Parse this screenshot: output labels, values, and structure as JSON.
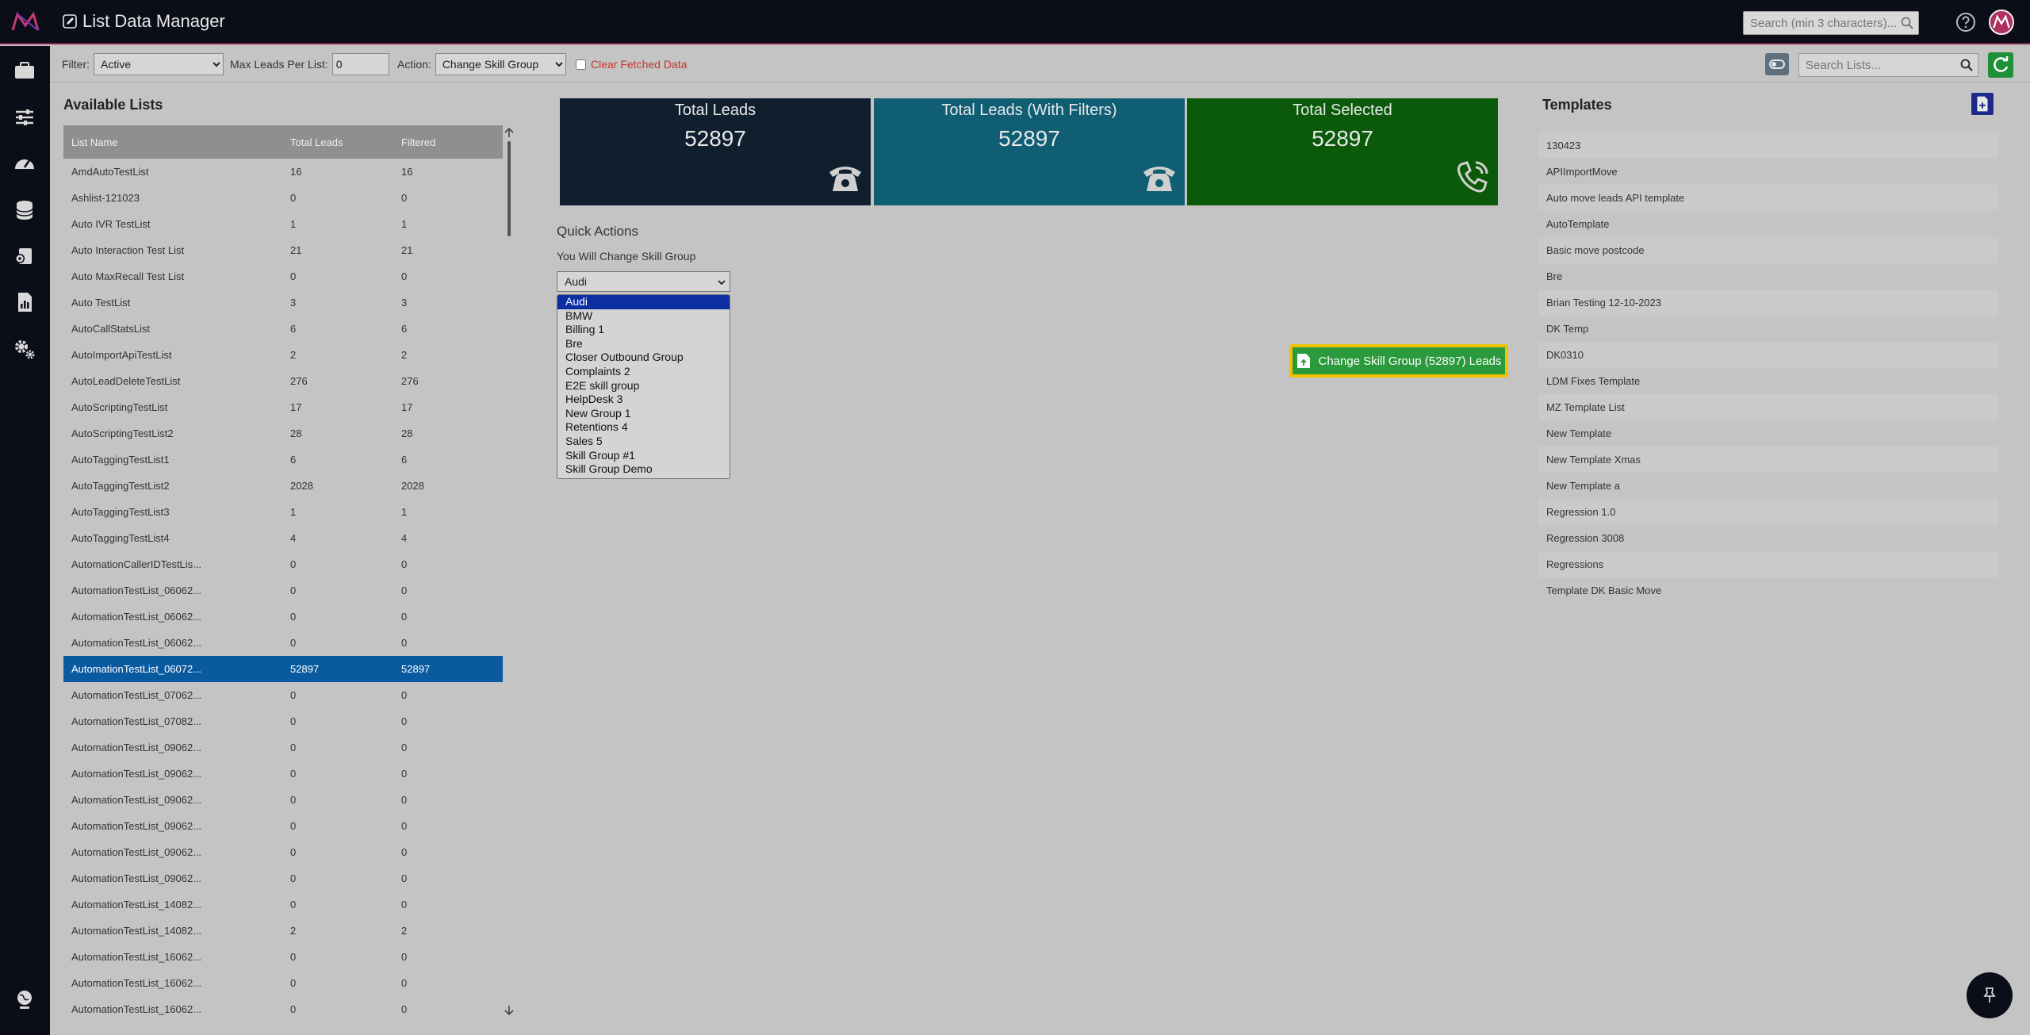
{
  "app": {
    "title": "List Data Manager",
    "search_placeholder": "Search (min 3 characters)..."
  },
  "filterbar": {
    "filter_label": "Filter:",
    "filter_value": "Active",
    "max_leads_label": "Max Leads Per List:",
    "max_leads_value": "0",
    "action_label": "Action:",
    "action_value": "Change Skill Group",
    "clear_label": "Clear Fetched Data",
    "list_search_placeholder": "Search Lists..."
  },
  "lists": {
    "title": "Available Lists",
    "columns": [
      "List Name",
      "Total Leads",
      "Filtered"
    ],
    "rows": [
      [
        "AmdAutoTestList",
        "16",
        "16"
      ],
      [
        "Ashlist-121023",
        "0",
        "0"
      ],
      [
        "Auto IVR TestList",
        "1",
        "1"
      ],
      [
        "Auto Interaction Test List",
        "21",
        "21"
      ],
      [
        "Auto MaxRecall Test List",
        "0",
        "0"
      ],
      [
        "Auto TestList",
        "3",
        "3"
      ],
      [
        "AutoCallStatsList",
        "6",
        "6"
      ],
      [
        "AutoImportApiTestList",
        "2",
        "2"
      ],
      [
        "AutoLeadDeleteTestList",
        "276",
        "276"
      ],
      [
        "AutoScriptingTestList",
        "17",
        "17"
      ],
      [
        "AutoScriptingTestList2",
        "28",
        "28"
      ],
      [
        "AutoTaggingTestList1",
        "6",
        "6"
      ],
      [
        "AutoTaggingTestList2",
        "2028",
        "2028"
      ],
      [
        "AutoTaggingTestList3",
        "1",
        "1"
      ],
      [
        "AutoTaggingTestList4",
        "4",
        "4"
      ],
      [
        "AutomationCallerIDTestLis...",
        "0",
        "0"
      ],
      [
        "AutomationTestList_06062...",
        "0",
        "0"
      ],
      [
        "AutomationTestList_06062...",
        "0",
        "0"
      ],
      [
        "AutomationTestList_06062...",
        "0",
        "0"
      ],
      [
        "AutomationTestList_06072...",
        "52897",
        "52897"
      ],
      [
        "AutomationTestList_07062...",
        "0",
        "0"
      ],
      [
        "AutomationTestList_07082...",
        "0",
        "0"
      ],
      [
        "AutomationTestList_09062...",
        "0",
        "0"
      ],
      [
        "AutomationTestList_09062...",
        "0",
        "0"
      ],
      [
        "AutomationTestList_09062...",
        "0",
        "0"
      ],
      [
        "AutomationTestList_09062...",
        "0",
        "0"
      ],
      [
        "AutomationTestList_09062...",
        "0",
        "0"
      ],
      [
        "AutomationTestList_09062...",
        "0",
        "0"
      ],
      [
        "AutomationTestList_14082...",
        "0",
        "0"
      ],
      [
        "AutomationTestList_14082...",
        "2",
        "2"
      ],
      [
        "AutomationTestList_16062...",
        "0",
        "0"
      ],
      [
        "AutomationTestList_16062...",
        "0",
        "0"
      ],
      [
        "AutomationTestList_16062...",
        "0",
        "0"
      ]
    ],
    "selected_index": 19
  },
  "cards": {
    "total_label": "Total Leads",
    "total_value": "52897",
    "filters_label": "Total Leads (With Filters)",
    "filters_value": "52897",
    "selected_label": "Total Selected",
    "selected_value": "52897"
  },
  "quick_actions": {
    "title": "Quick Actions",
    "description": "You Will Change Skill Group",
    "selected": "Audi",
    "options": [
      "Audi",
      "BMW",
      "Billing 1",
      "Bre",
      "Closer Outbound Group",
      "Complaints 2",
      "E2E skill group",
      "HelpDesk 3",
      "New Group 1",
      "Retentions 4",
      "Sales 5",
      "Skill Group #1",
      "Skill Group Demo"
    ],
    "button_label": "Change Skill Group (52897) Leads"
  },
  "templates": {
    "title": "Templates",
    "items": [
      "130423",
      "APIImportMove",
      "Auto move leads API template",
      "AutoTemplate",
      "Basic move postcode",
      "Bre",
      "Brian Testing 12-10-2023",
      "DK Temp",
      "DK0310",
      "LDM Fixes Template",
      "MZ Template List",
      "New Template",
      "New Template Xmas",
      "New Template a",
      "Regression 1.0",
      "Regression 3008",
      "Regressions",
      "Template DK Basic Move"
    ]
  },
  "colors": {
    "accent": "#7a1f4a",
    "selected_row": "#0a5aa0",
    "action_button": "#2a9a3c",
    "highlight_border": "#f2c200"
  }
}
